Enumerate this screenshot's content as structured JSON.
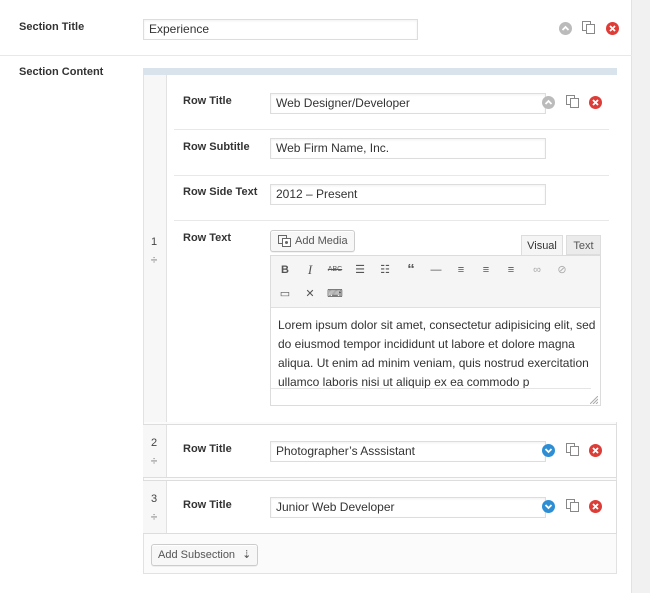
{
  "section": {
    "title_label": "Section Title",
    "title_value": "Experience",
    "content_label": "Section Content"
  },
  "rows": [
    {
      "number": "1",
      "title_label": "Row Title",
      "title_value": "Web Designer/Developer",
      "subtitle_label": "Row Subtitle",
      "subtitle_value": "Web Firm Name, Inc.",
      "side_label": "Row Side Text",
      "side_value": "2012 – Present",
      "text_label": "Row Text"
    },
    {
      "number": "2",
      "title_label": "Row Title",
      "title_value": "Photographer’s Asssistant"
    },
    {
      "number": "3",
      "title_label": "Row Title",
      "title_value": "Junior Web Developer"
    }
  ],
  "editor": {
    "add_media_label": "Add Media",
    "tab_visual": "Visual",
    "tab_text": "Text",
    "body": "Lorem ipsum dolor sit amet, consectetur adipisicing elit, sed do eiusmod tempor incididunt ut labore et dolore magna aliqua. Ut enim ad minim veniam, quis nostrud exercitation ullamco laboris nisi ut aliquip ex ea commodo p"
  },
  "add_subsection_label": "Add Subsection",
  "colors": {
    "delete": "#dd3d36",
    "expand": "#2e8ed4",
    "collapse": "#bbbbbb",
    "band": "#d8e3ec"
  }
}
